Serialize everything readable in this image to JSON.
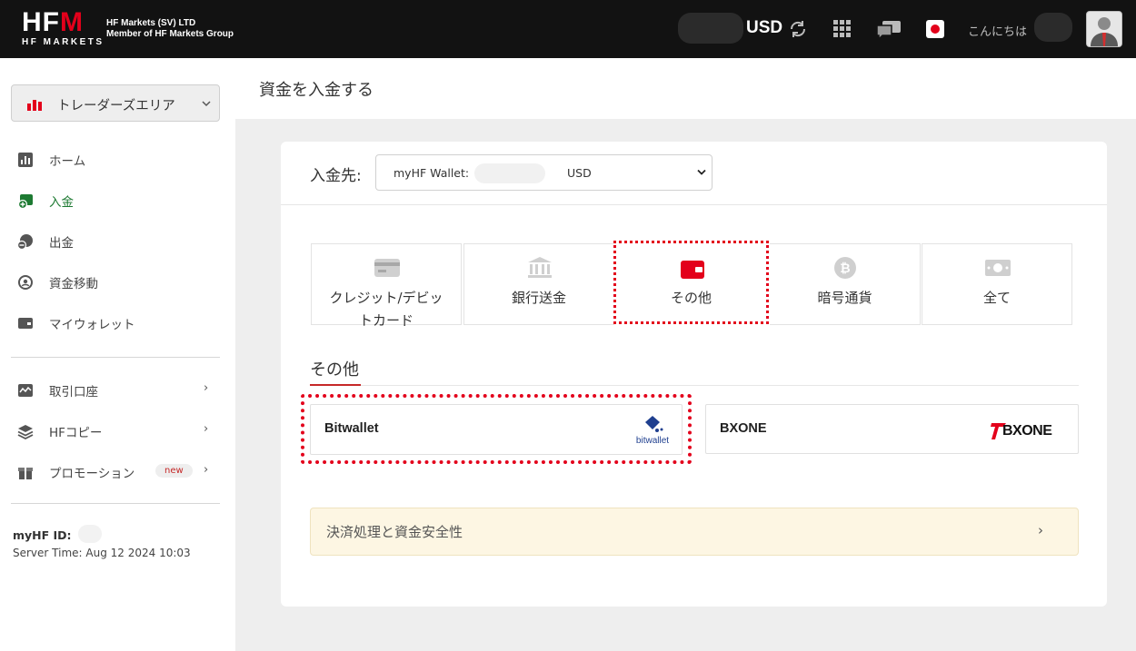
{
  "header": {
    "logo_text_a": "HF",
    "logo_text_b": "M",
    "logo_sub": "HF MARKETS",
    "company_line1": "HF Markets (SV) LTD",
    "company_line2": "Member of HF Markets Group",
    "currency": "USD",
    "greeting": "こんにちは"
  },
  "sidebar": {
    "area_selector": "トレーダーズエリア",
    "items": [
      {
        "label": "ホーム",
        "icon": "chart-icon"
      },
      {
        "label": "入金",
        "icon": "deposit-icon"
      },
      {
        "label": "出金",
        "icon": "withdraw-icon"
      },
      {
        "label": "資金移動",
        "icon": "transfer-icon"
      },
      {
        "label": "マイウォレット",
        "icon": "wallet-icon"
      }
    ],
    "groups": [
      {
        "label": "取引口座",
        "icon": "accounts-icon"
      },
      {
        "label": "HFコピー",
        "icon": "layers-icon"
      },
      {
        "label": "プロモーション",
        "icon": "gift-icon",
        "badge": "new"
      }
    ],
    "myhf_id_label": "myHF ID:",
    "server_time": "Server Time: Aug 12 2024 10:03"
  },
  "main": {
    "page_title": "資金を入金する",
    "deposit_to_label": "入金先:",
    "wallet_label": "myHF Wallet:",
    "wallet_currency": "USD",
    "methods": [
      {
        "label": "クレジット/デビットカード",
        "line1": "クレジット/デビッ",
        "line2": "トカード",
        "icon": "credit-card-icon"
      },
      {
        "label": "銀行送金",
        "icon": "bank-icon"
      },
      {
        "label": "その他",
        "icon": "wallet-icon",
        "selected": true
      },
      {
        "label": "暗号通貨",
        "icon": "bitcoin-icon"
      },
      {
        "label": "全て",
        "icon": "money-icon"
      }
    ],
    "section_title": "その他",
    "providers": [
      {
        "name": "Bitwallet",
        "logo_text": "bitwallet"
      },
      {
        "name": "BXONE",
        "logo_text": "BXONE"
      }
    ],
    "info_bar": "決済処理と資金安全性"
  },
  "colors": {
    "accent_red": "#e3001b",
    "active_green": "#1d7a32",
    "topbar": "#121212"
  }
}
